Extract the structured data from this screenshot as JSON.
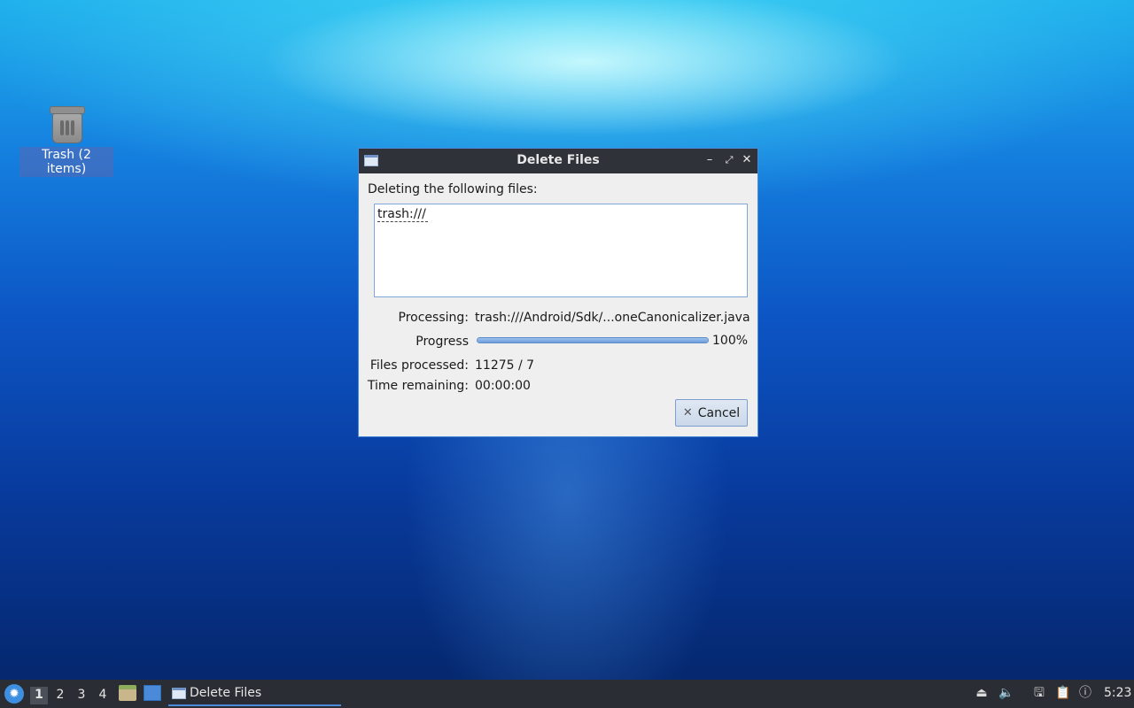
{
  "desktop": {
    "trash_label": "Trash (2 items)"
  },
  "dialog": {
    "title": "Delete Files",
    "heading": "Deleting the following files:",
    "files": [
      "trash:///"
    ],
    "processing_label": "Processing:",
    "processing_value": "trash:///Android/Sdk/...oneCanonicalizer.java",
    "progress_label": "Progress",
    "progress_fraction": 1.0,
    "progress_text": "100%",
    "files_processed_label": "Files processed:",
    "files_processed_value": "11275 / 7",
    "time_remaining_label": "Time remaining:",
    "time_remaining_value": "00:00:00",
    "cancel_label": "Cancel"
  },
  "taskbar": {
    "workspaces": [
      "1",
      "2",
      "3",
      "4"
    ],
    "active_workspace": "1",
    "task_label": "Delete Files",
    "clock": "5:23"
  },
  "colors": {
    "accent": "#4a8ad8",
    "titlebar": "#2f3238",
    "taskbar": "#2a2d33"
  }
}
